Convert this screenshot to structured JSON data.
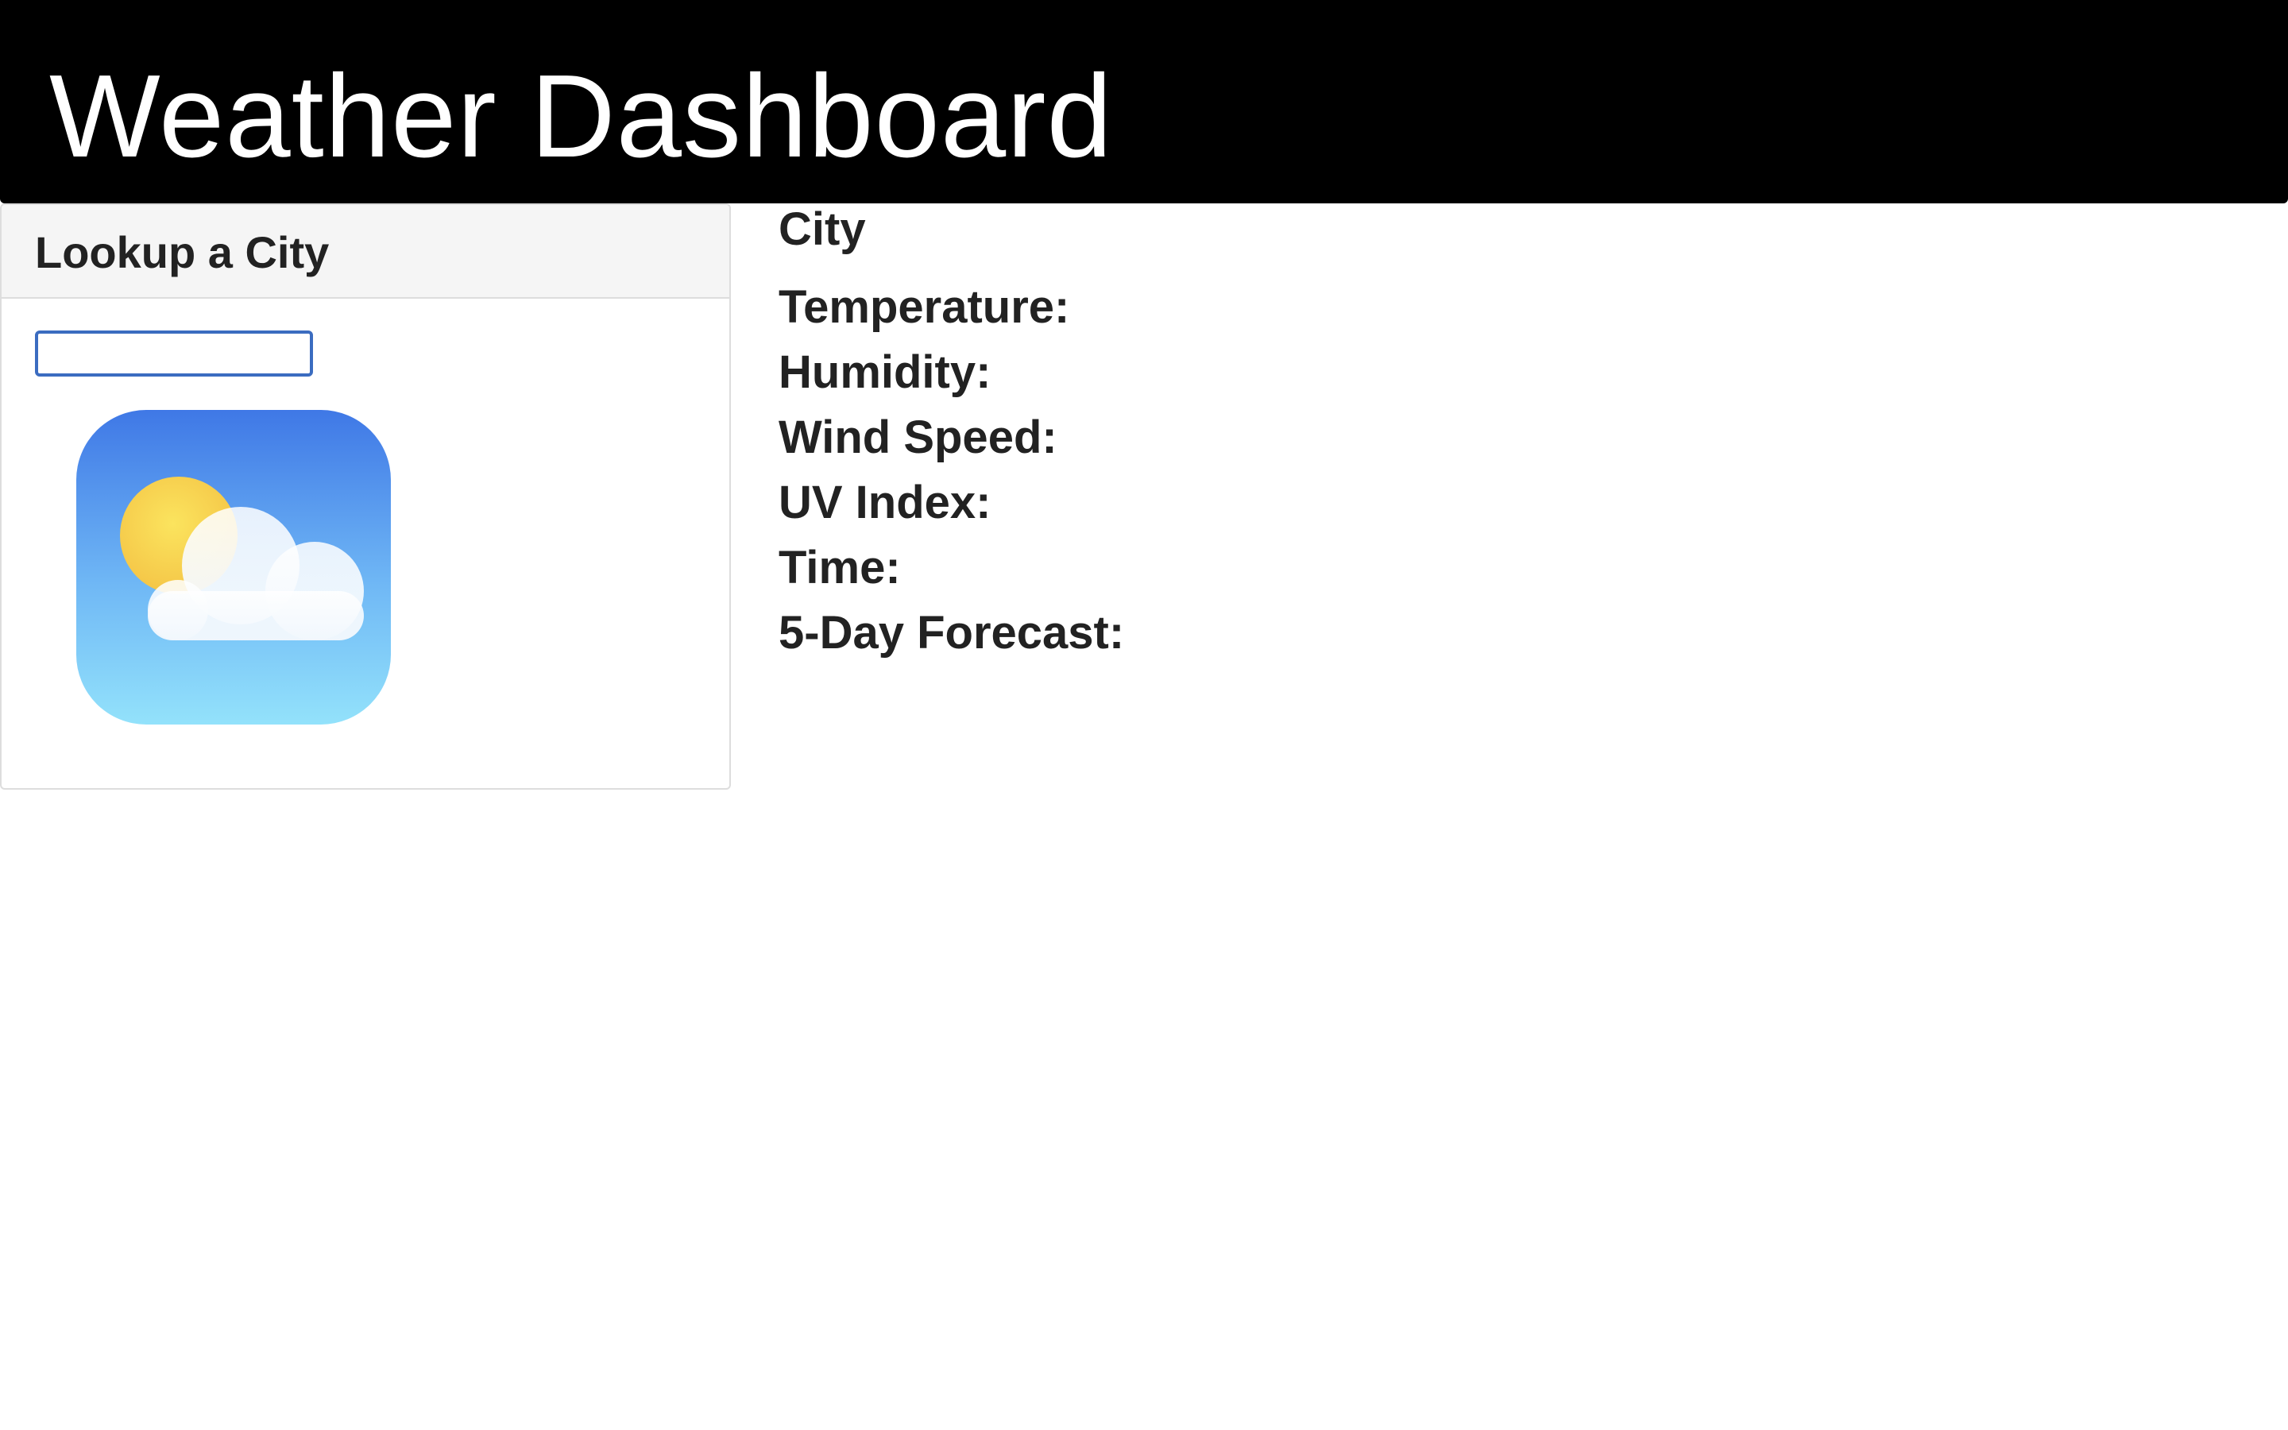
{
  "header": {
    "title": "Weather Dashboard"
  },
  "lookup": {
    "heading": "Lookup a City",
    "search_value": "",
    "logo_icon": "sun-cloud-weather-icon"
  },
  "details": {
    "city": "City",
    "temperature_label": "Temperature:",
    "humidity_label": "Humidity:",
    "wind_speed_label": "Wind Speed:",
    "uv_index_label": "UV Index:",
    "time_label": "Time:",
    "forecast_label": "5-Day Forecast:"
  },
  "colors": {
    "header_bg": "#000000",
    "header_text": "#ffffff",
    "input_focus_border": "#3b6cc0",
    "panel_heading_bg": "#f5f5f5"
  }
}
